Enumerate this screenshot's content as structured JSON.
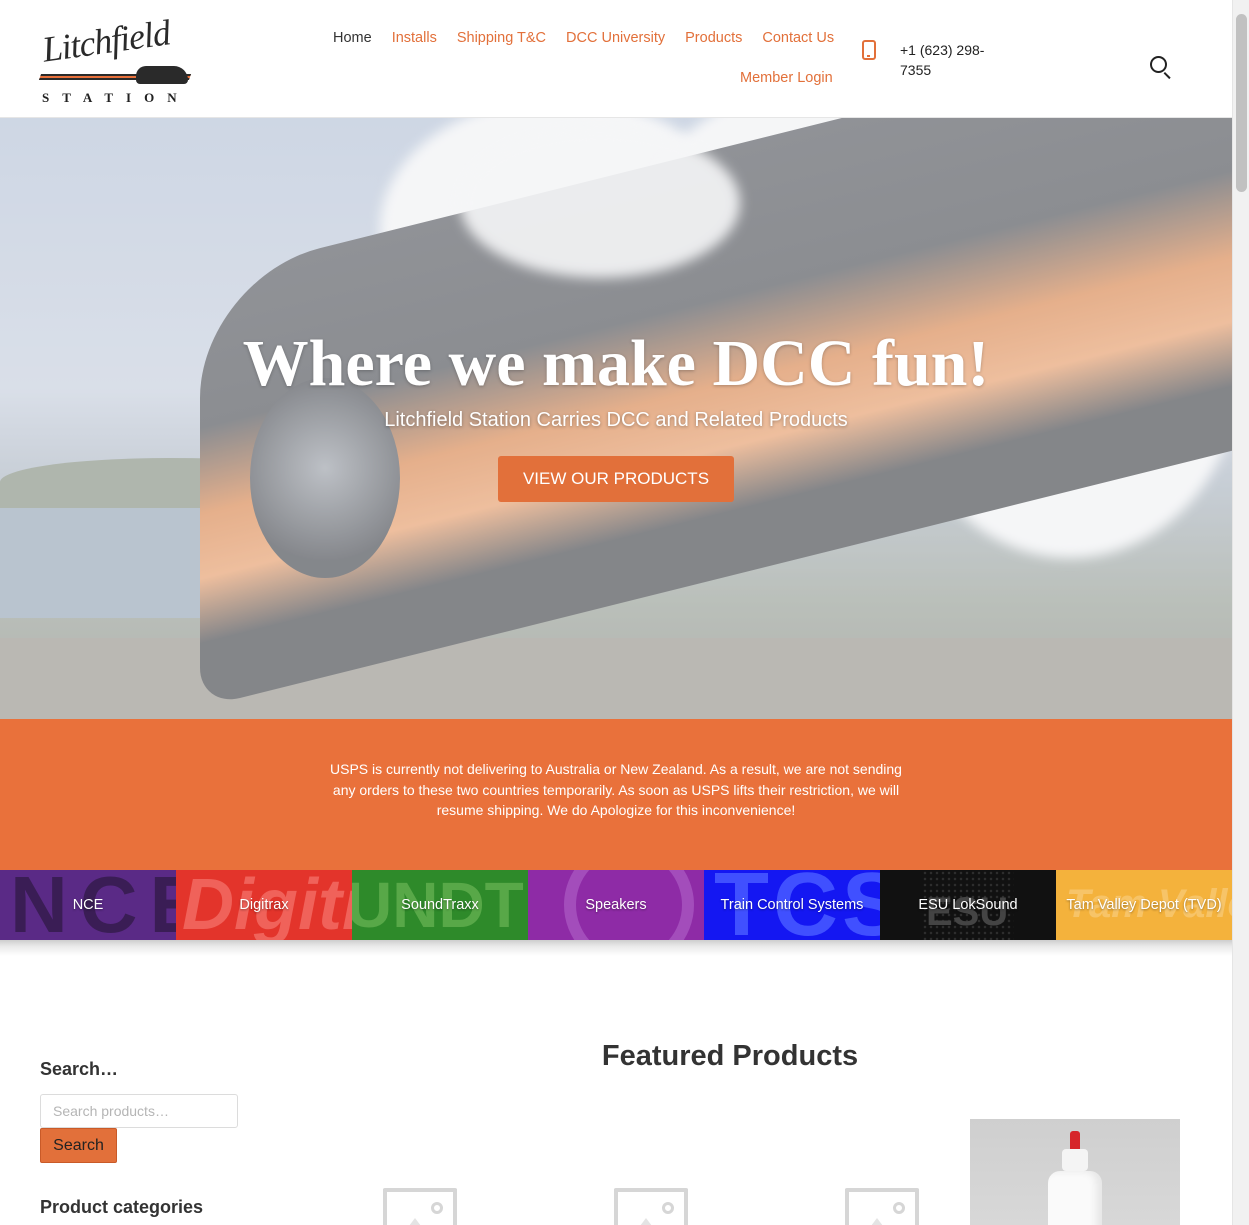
{
  "header": {
    "logo_script": "Litchfield",
    "logo_station": "STATION",
    "nav": [
      {
        "label": "Home",
        "active": true
      },
      {
        "label": "Installs"
      },
      {
        "label": "Shipping T&C"
      },
      {
        "label": "DCC University"
      },
      {
        "label": "Products"
      },
      {
        "label": "Contact Us"
      },
      {
        "label": "Member Login"
      }
    ],
    "phone": "+1 (623) 298-7355",
    "search_icon": "search-icon",
    "phone_icon": "mobile-phone-icon"
  },
  "hero": {
    "title": "Where we make DCC fun!",
    "subtitle": "Litchfield Station Carries DCC and Related Products",
    "button_label": "VIEW OUR PRODUCTS"
  },
  "notice": {
    "text": "USPS is currently not delivering to Australia or New Zealand. As a result, we are not sending any orders to these two countries temporarily. As soon as USPS lifts their restriction, we will resume shipping. We do Apologize for this inconvenience!"
  },
  "brands": [
    {
      "label": "NCE",
      "bg_text": "NCE"
    },
    {
      "label": "Digitrax",
      "bg_text": "Digitrax"
    },
    {
      "label": "SoundTraxx",
      "bg_text": "UNDTRAX"
    },
    {
      "label": "Speakers"
    },
    {
      "label": "Train Control Systems",
      "bg_text": "TCS"
    },
    {
      "label": "ESU LokSound",
      "bg_text": "ESU"
    },
    {
      "label": "Tam Valley Depot (TVD)",
      "bg_text": "Tam Valley"
    }
  ],
  "sidebar": {
    "search_title": "Search…",
    "search_placeholder": "Search products…",
    "search_button": "Search",
    "categories_title": "Product categories"
  },
  "featured": {
    "title": "Featured Products"
  },
  "colors": {
    "accent": "#e2703a",
    "notice_bg": "#e9713b"
  }
}
